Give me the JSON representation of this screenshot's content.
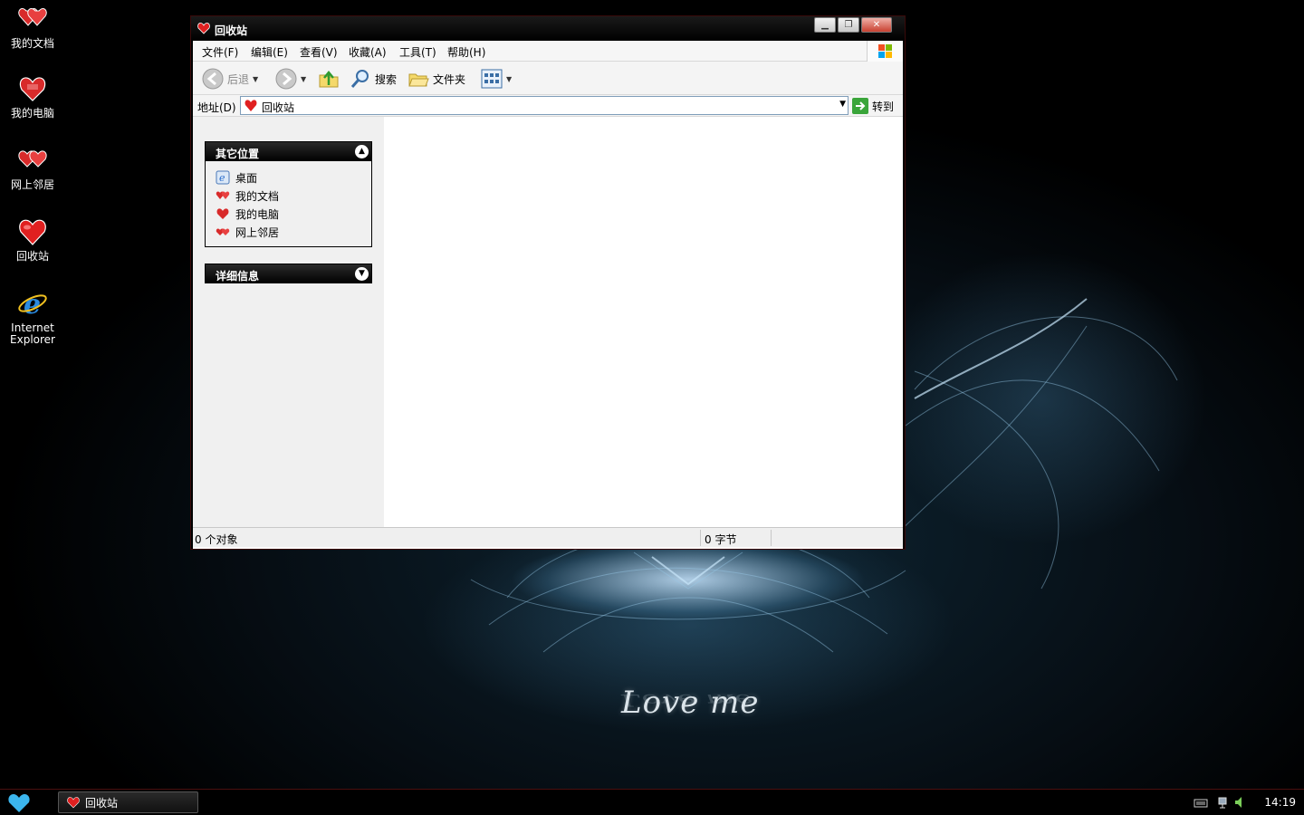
{
  "desktop": {
    "icons": [
      {
        "label": "我的文档",
        "icon": "hearts-documents-icon"
      },
      {
        "label": "我的电脑",
        "icon": "heart-computer-icon"
      },
      {
        "label": "网上邻居",
        "icon": "hearts-network-icon"
      },
      {
        "label": "回收站",
        "icon": "heart-recycle-bin-icon"
      },
      {
        "label": "Internet Explorer",
        "icon": "internet-explorer-icon"
      }
    ],
    "wallpaper_text": "Love me"
  },
  "window": {
    "title": "回收站",
    "menu": [
      "文件(F)",
      "编辑(E)",
      "查看(V)",
      "收藏(A)",
      "工具(T)",
      "帮助(H)"
    ],
    "toolbar": {
      "back_label": "后退",
      "search_label": "搜索",
      "folders_label": "文件夹"
    },
    "address": {
      "label": "地址(D)",
      "value": "回收站",
      "go_label": "转到"
    },
    "tasks": {
      "other_places": {
        "title": "其它位置",
        "items": [
          "桌面",
          "我的文档",
          "我的电脑",
          "网上邻居"
        ]
      },
      "details": {
        "title": "详细信息"
      }
    },
    "status": {
      "objects": "0 个对象",
      "size": "0 字节"
    }
  },
  "taskbar": {
    "task_label": "回收站",
    "clock": "14:19"
  },
  "colors": {
    "accent_red": "#d32020",
    "title_black": "#000000",
    "start_heart": "#3bb6ee"
  }
}
